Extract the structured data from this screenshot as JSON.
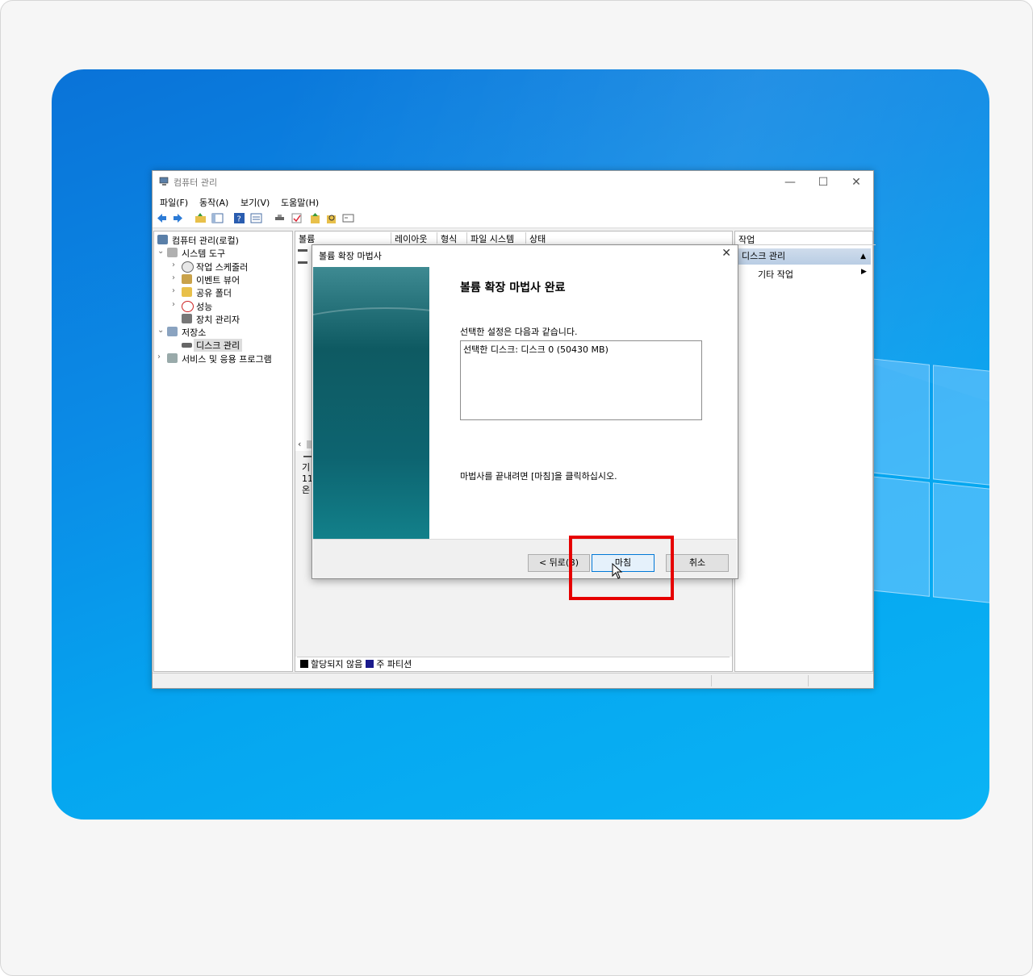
{
  "window": {
    "title": "컴퓨터 관리",
    "menu": [
      "파일(F)",
      "동작(A)",
      "보기(V)",
      "도움말(H)"
    ],
    "tree": {
      "root": "컴퓨터 관리(로컬)",
      "system_tools": "시스템 도구",
      "task_scheduler": "작업 스케줄러",
      "event_viewer": "이벤트 뷰어",
      "shared_folders": "공유 폴더",
      "performance": "성능",
      "device_manager": "장치 관리자",
      "storage": "저장소",
      "disk_management": "디스크 관리",
      "services": "서비스 및 응용 프로그램"
    },
    "columns": [
      "볼륨",
      "레이아웃",
      "형식",
      "파일 시스템",
      "상태"
    ],
    "lower_fragments": [
      "기",
      "11",
      "온"
    ],
    "legend": {
      "unallocated": "할당되지 않음",
      "primary": "주 파티션"
    },
    "actions": {
      "header": "작업",
      "section": "디스크 관리",
      "more": "기타 작업"
    }
  },
  "dialog": {
    "title": "볼륨 확장 마법사",
    "heading": "볼륨 확장 마법사 완료",
    "subtitle": "선택한 설정은 다음과 같습니다.",
    "settings_line": "선택한 디스크: 디스크 0 (50430 MB)",
    "finish_instruction": "마법사를 끝내려면 [마침]을 클릭하십시오.",
    "back_label": "< 뒤로(B)",
    "finish_label": "마침",
    "cancel_label": "취소"
  },
  "colors": {
    "highlight": "#e60000",
    "desktop": "#0a8be6",
    "wizard_side": "#0e5a62"
  }
}
